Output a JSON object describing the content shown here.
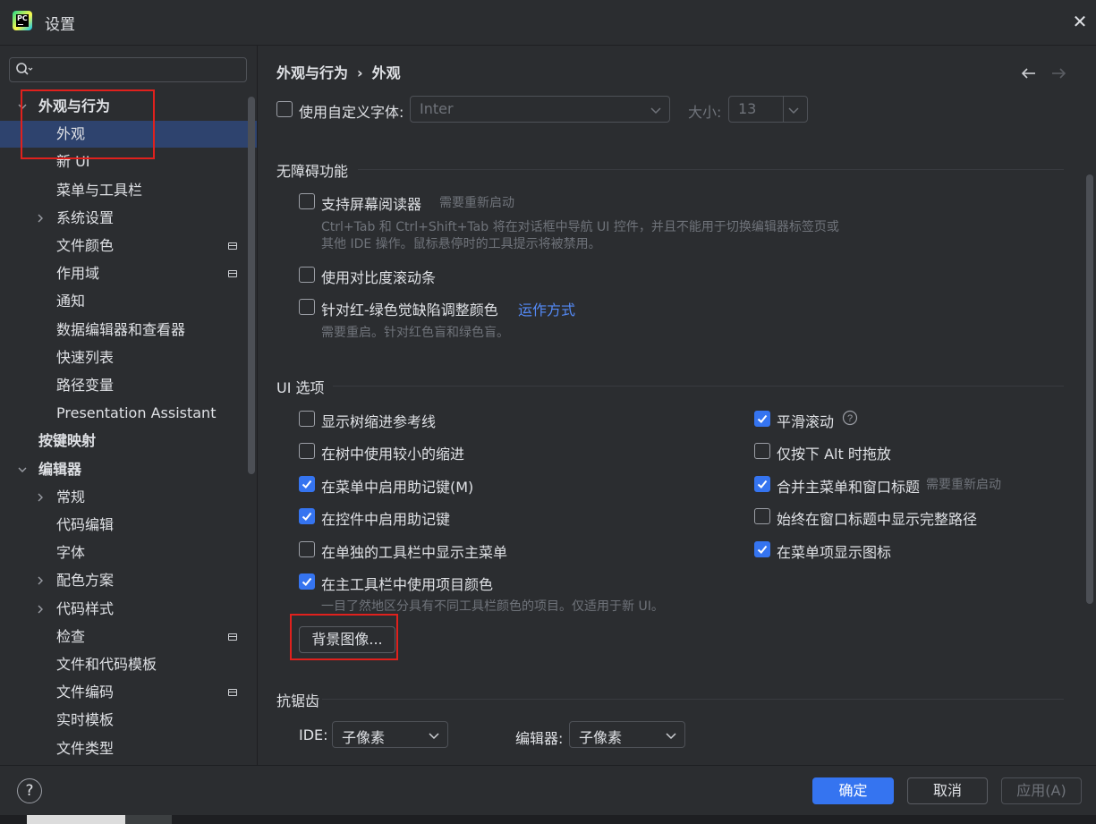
{
  "window": {
    "title": "设置"
  },
  "search": {
    "placeholder": ""
  },
  "sidebar": {
    "items": [
      {
        "label": "外观与行为",
        "bold": true,
        "arrow": "down"
      },
      {
        "label": "外观",
        "selected": true
      },
      {
        "label": "新 UI"
      },
      {
        "label": "菜单与工具栏"
      },
      {
        "label": "系统设置",
        "arrow": "right"
      },
      {
        "label": "文件颜色",
        "badge": true
      },
      {
        "label": "作用域",
        "badge": true
      },
      {
        "label": "通知"
      },
      {
        "label": "数据编辑器和查看器"
      },
      {
        "label": "快速列表"
      },
      {
        "label": "路径变量"
      },
      {
        "label": "Presentation Assistant"
      },
      {
        "label": "按键映射",
        "bold": true
      },
      {
        "label": "编辑器",
        "bold": true,
        "arrow": "down"
      },
      {
        "label": "常规",
        "arrow": "right"
      },
      {
        "label": "代码编辑"
      },
      {
        "label": "字体"
      },
      {
        "label": "配色方案",
        "arrow": "right"
      },
      {
        "label": "代码样式",
        "arrow": "right"
      },
      {
        "label": "检查",
        "badge": true
      },
      {
        "label": "文件和代码模板"
      },
      {
        "label": "文件编码",
        "badge": true
      },
      {
        "label": "实时模板"
      },
      {
        "label": "文件类型"
      }
    ]
  },
  "breadcrumb": {
    "parent": "外观与行为",
    "separator": "›",
    "current": "外观"
  },
  "font_row": {
    "checkbox_label": "使用自定义字体:",
    "checked": false,
    "font_value": "Inter",
    "size_label": "大小:",
    "size_value": "13"
  },
  "accessibility": {
    "title": "无障碍功能",
    "screen_reader": {
      "label": "支持屏幕阅读器",
      "note": "需要重新启动",
      "checked": false,
      "hint_line1": "Ctrl+Tab 和 Ctrl+Shift+Tab 将在对话框中导航 UI 控件，并且不能用于切换编辑器标签页或",
      "hint_line2": "其他 IDE 操作。鼠标悬停时的工具提示将被禁用。"
    },
    "contrast_scrollbars": {
      "label": "使用对比度滚动条",
      "checked": false
    },
    "color_deficiency": {
      "label": "针对红-绿色觉缺陷调整颜色",
      "link": "运作方式",
      "checked": false,
      "hint": "需要重启。针对红色盲和绿色盲。"
    }
  },
  "ui_options": {
    "title": "UI 选项",
    "left": [
      {
        "label": "显示树缩进参考线",
        "checked": false
      },
      {
        "label": "在树中使用较小的缩进",
        "checked": false
      },
      {
        "label": "在菜单中启用助记键(M)",
        "checked": true
      },
      {
        "label": "在控件中启用助记键",
        "checked": true
      },
      {
        "label": "在单独的工具栏中显示主菜单",
        "checked": false
      },
      {
        "label": "在主工具栏中使用项目颜色",
        "checked": true
      }
    ],
    "right": [
      {
        "label": "平滑滚动",
        "checked": true,
        "help": "?"
      },
      {
        "label": "仅按下 Alt 时拖放",
        "checked": false
      },
      {
        "label": "合并主菜单和窗口标题",
        "checked": true,
        "note": "需要重新启动"
      },
      {
        "label": "始终在窗口标题中显示完整路径",
        "checked": false
      },
      {
        "label": "在菜单项显示图标",
        "checked": true
      }
    ],
    "project_color_hint": "一目了然地区分具有不同工具栏颜色的项目。仅适用于新 UI。",
    "background_button": "背景图像..."
  },
  "antialiasing": {
    "title": "抗锯齿",
    "ide_label": "IDE:",
    "ide_value": "子像素",
    "editor_label": "编辑器:",
    "editor_value": "子像素"
  },
  "footer": {
    "help": "?",
    "ok": "确定",
    "cancel": "取消",
    "apply": "应用(A)"
  },
  "colors": {
    "background": "#2b2d30",
    "accent": "#3574f0",
    "selection": "#2e436e",
    "link": "#548af7",
    "highlight_box": "#e0211d"
  }
}
